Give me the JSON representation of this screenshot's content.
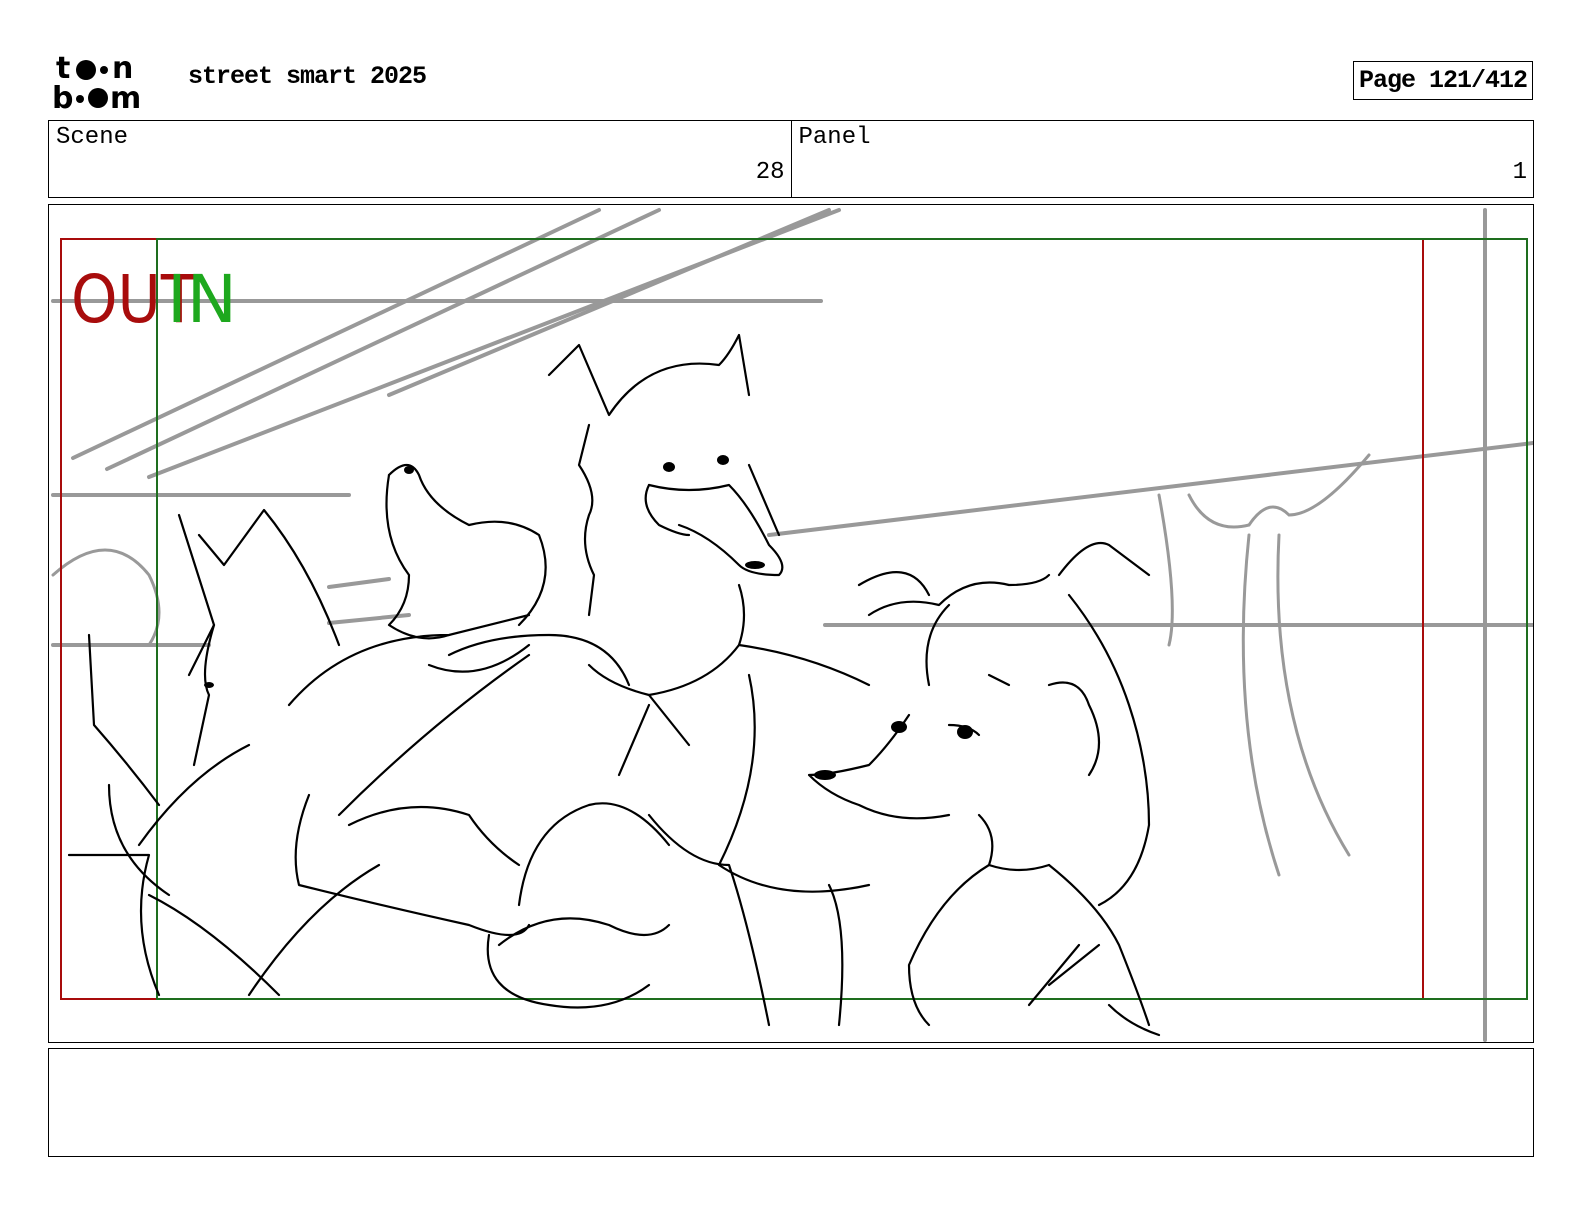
{
  "header": {
    "logo_text": "toon boom",
    "project_title": "street smart 2025",
    "page_indicator": "Page 121/412"
  },
  "info": {
    "scene_label": "Scene",
    "scene_number": "28",
    "panel_label": "Panel",
    "panel_number": "1"
  },
  "panel": {
    "out_label": "OUT",
    "in_label": "IN",
    "out_color": "#a80c0c",
    "in_color": "#1ea81e",
    "sketch_rough_color": "#999999",
    "sketch_ink_color": "#000000"
  },
  "dialogue": {
    "text": ""
  }
}
